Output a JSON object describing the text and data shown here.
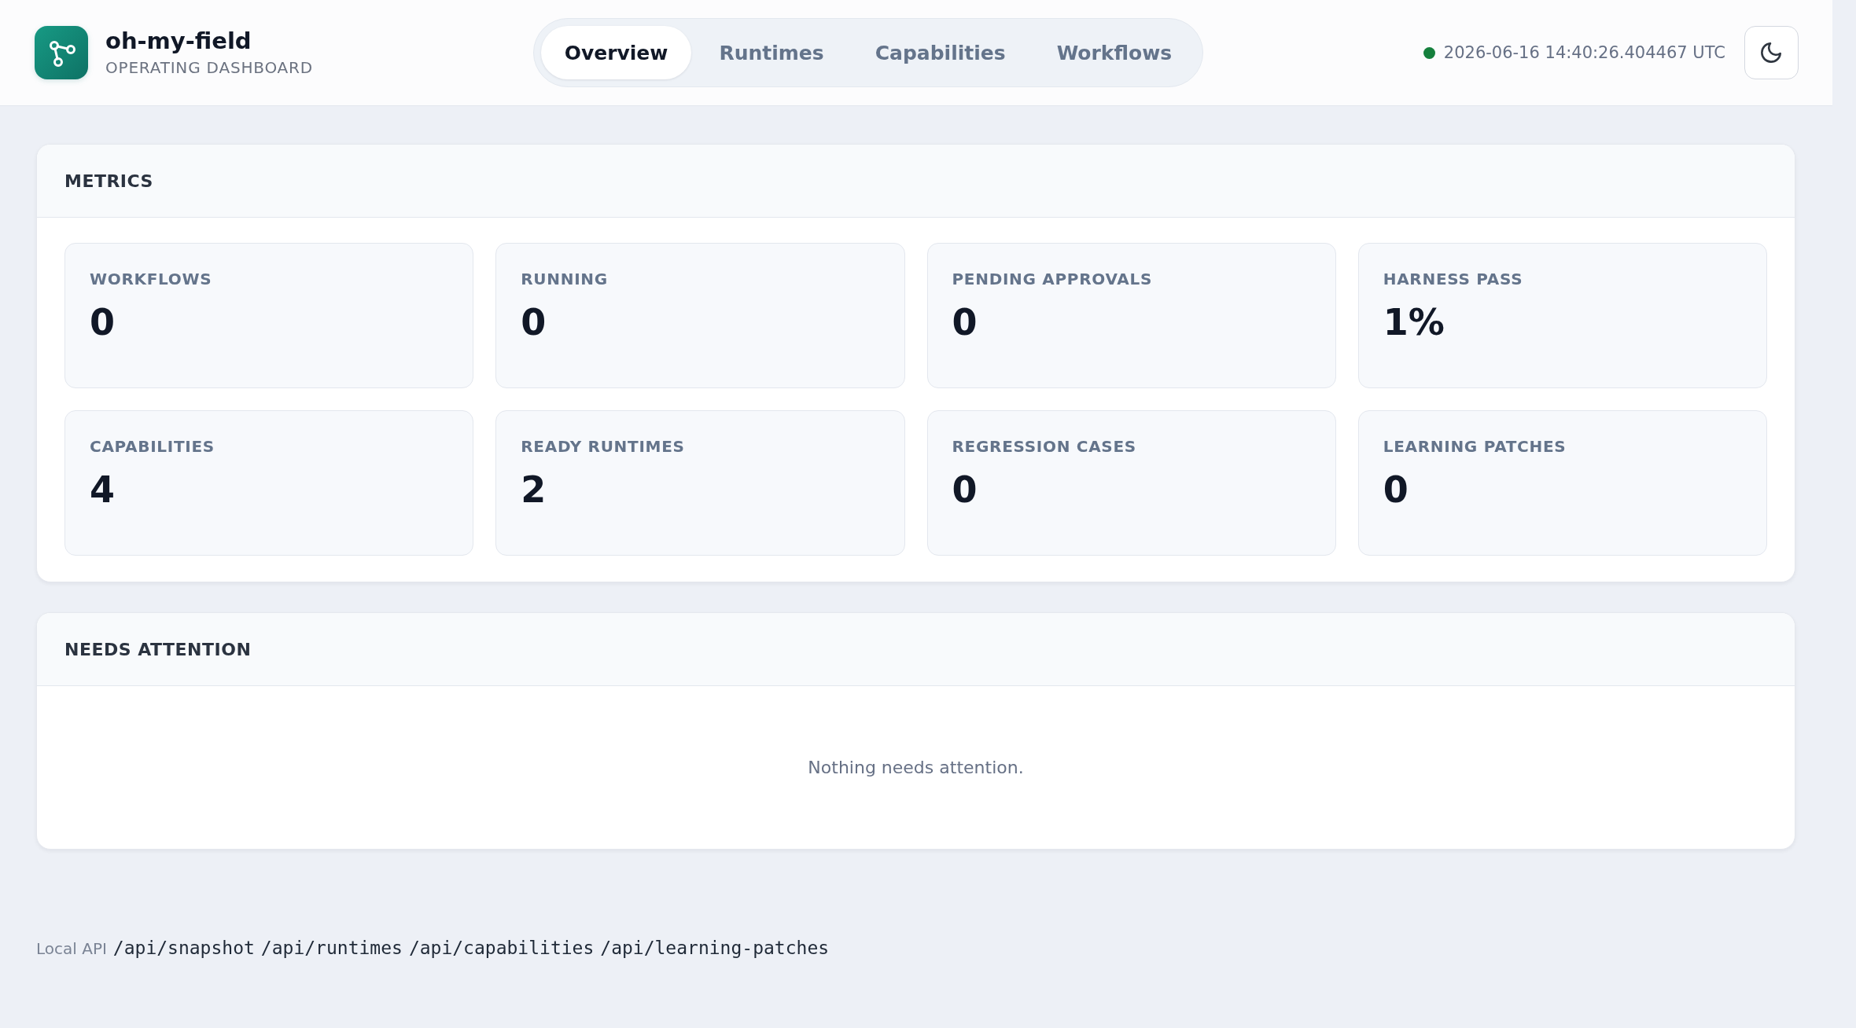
{
  "header": {
    "app_name": "oh-my-field",
    "subtitle": "OPERATING DASHBOARD"
  },
  "nav": {
    "tabs": [
      {
        "label": "Overview",
        "selected": true
      },
      {
        "label": "Runtimes",
        "selected": false
      },
      {
        "label": "Capabilities",
        "selected": false
      },
      {
        "label": "Workflows",
        "selected": false
      }
    ]
  },
  "status": {
    "online": true,
    "timestamp": "2026-06-16 14:40:26.404467 UTC"
  },
  "metrics": {
    "title": "METRICS",
    "cards": [
      {
        "label": "WORKFLOWS",
        "value": "0"
      },
      {
        "label": "RUNNING",
        "value": "0"
      },
      {
        "label": "PENDING APPROVALS",
        "value": "0"
      },
      {
        "label": "HARNESS PASS",
        "value": "1%"
      },
      {
        "label": "CAPABILITIES",
        "value": "4"
      },
      {
        "label": "READY RUNTIMES",
        "value": "2"
      },
      {
        "label": "REGRESSION CASES",
        "value": "0"
      },
      {
        "label": "LEARNING PATCHES",
        "value": "0"
      }
    ]
  },
  "needs_attention": {
    "title": "NEEDS ATTENTION",
    "empty_message": "Nothing needs attention."
  },
  "footer": {
    "label": "Local API",
    "endpoints": [
      "/api/snapshot",
      "/api/runtimes",
      "/api/capabilities",
      "/api/learning-patches"
    ]
  }
}
